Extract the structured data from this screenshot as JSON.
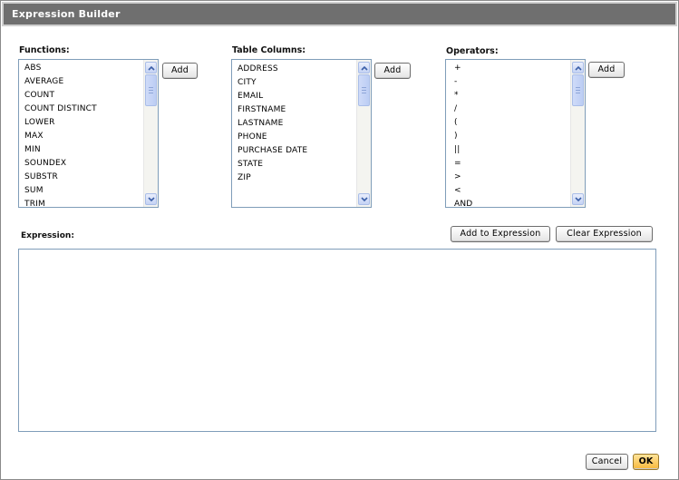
{
  "window": {
    "title": "Expression Builder"
  },
  "functions": {
    "label": "Functions:",
    "items": [
      "ABS",
      "AVERAGE",
      "COUNT",
      "COUNT DISTINCT",
      "LOWER",
      "MAX",
      "MIN",
      "SOUNDEX",
      "SUBSTR",
      "SUM",
      "TRIM"
    ],
    "add_label": "Add"
  },
  "columns": {
    "label": "Table Columns:",
    "items": [
      "ADDRESS",
      "CITY",
      "EMAIL",
      "FIRSTNAME",
      "LASTNAME",
      "PHONE",
      "PURCHASE DATE",
      "STATE",
      "ZIP"
    ],
    "add_label": "Add"
  },
  "operators": {
    "label": "Operators:",
    "items": [
      "+",
      "-",
      "*",
      "/",
      "(",
      ")",
      "||",
      "=",
      ">",
      "<",
      "AND"
    ],
    "add_label": "Add"
  },
  "expression": {
    "label": "Expression:",
    "value": "",
    "add_to_expression_label": "Add to Expression",
    "clear_expression_label": "Clear Expression"
  },
  "footer": {
    "cancel_label": "Cancel",
    "ok_label": "OK"
  },
  "icons": {
    "scroll_up": "chevron-up-icon",
    "scroll_down": "chevron-down-icon"
  },
  "colors": {
    "titlebar": "#6f6f6f",
    "ok_button": "#f7b83a",
    "list_border": "#7f9db9",
    "scroll_accent": "#c4d2f4"
  }
}
